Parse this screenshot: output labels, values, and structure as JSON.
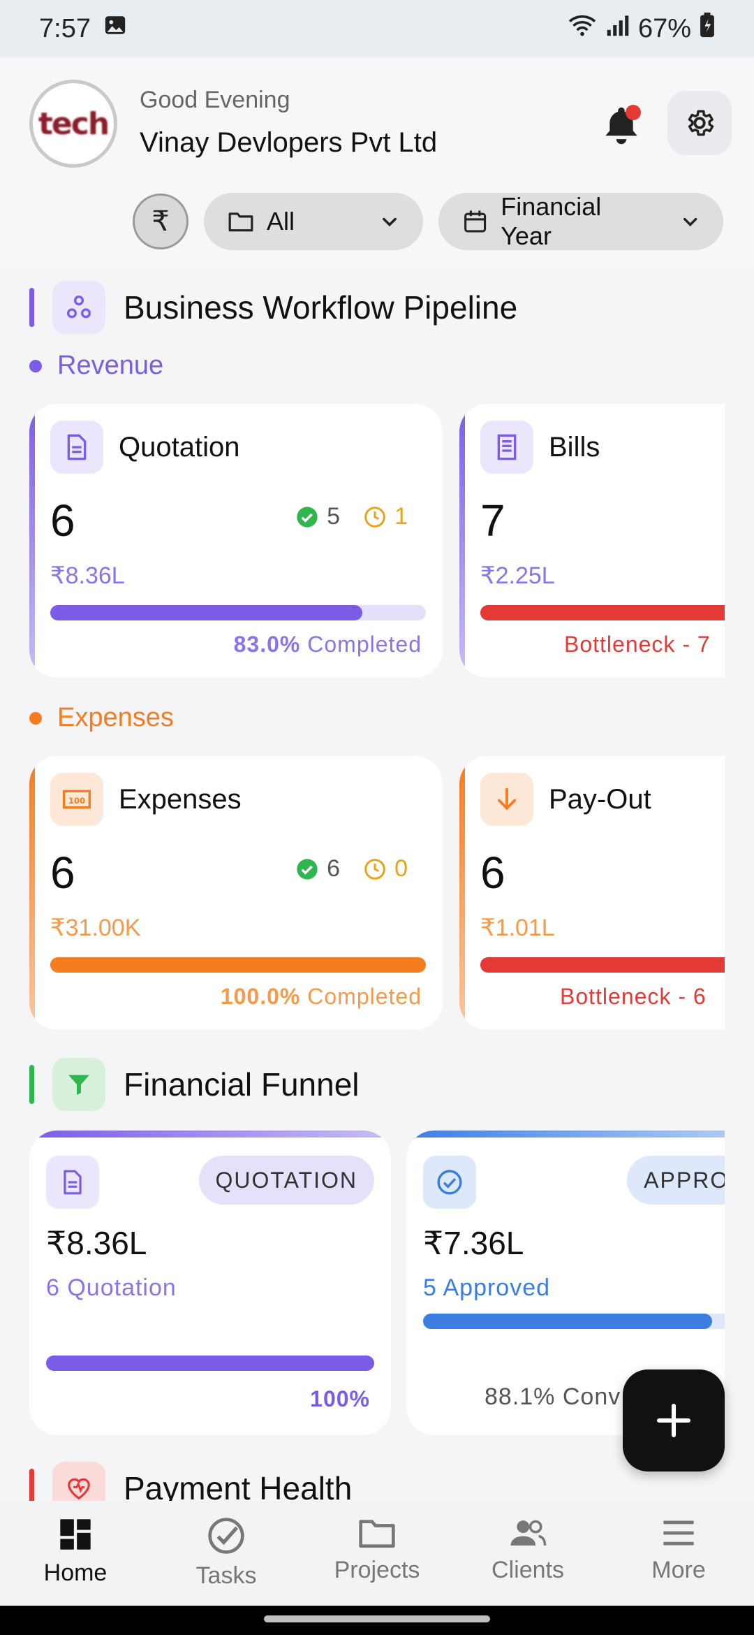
{
  "status": {
    "time": "7:57",
    "battery": "67%"
  },
  "header": {
    "logo_text": "tech",
    "greeting": "Good Evening",
    "company": "Vinay Devlopers Pvt Ltd"
  },
  "filters": {
    "currency_symbol": "₹",
    "folder_label": "All",
    "period_label": "Financial Year"
  },
  "pipeline": {
    "title": "Business Workflow Pipeline",
    "revenue": {
      "label": "Revenue",
      "cards": [
        {
          "name": "Quotation",
          "count": "6",
          "done": "5",
          "pending": "1",
          "amount": "₹8.36L",
          "progress": 83.0,
          "pct_label": "83.0%",
          "status_label": "Completed"
        },
        {
          "name": "Bills",
          "count": "7",
          "amount": "₹2.25L",
          "progress": 100,
          "status_label": "Bottleneck - 7"
        }
      ]
    },
    "expenses": {
      "label": "Expenses",
      "cards": [
        {
          "name": "Expenses",
          "count": "6",
          "done": "6",
          "pending": "0",
          "amount": "₹31.00K",
          "progress": 100.0,
          "pct_label": "100.0%",
          "status_label": "Completed"
        },
        {
          "name": "Pay-Out",
          "count": "6",
          "amount": "₹1.01L",
          "progress": 100,
          "status_label": "Bottleneck - 6"
        }
      ]
    }
  },
  "funnel": {
    "title": "Financial Funnel",
    "cards": [
      {
        "tag": "QUOTATION",
        "amount": "₹8.36L",
        "sub": "6 Quotation",
        "progress": 100,
        "pct_label": "100%"
      },
      {
        "tag": "APPROVED",
        "amount": "₹7.36L",
        "sub": "5 Approved",
        "progress": 88.1,
        "pct_label": "88",
        "conversion": "88.1% Conv"
      }
    ]
  },
  "payment_health": {
    "title": "Payment Health"
  },
  "nav": {
    "home": "Home",
    "tasks": "Tasks",
    "projects": "Projects",
    "clients": "Clients",
    "more": "More"
  },
  "colors": {
    "purple": "#7b5ce6",
    "orange": "#f57c1f",
    "red": "#e53935",
    "green": "#2fb64c",
    "blue": "#3b7ee0"
  }
}
